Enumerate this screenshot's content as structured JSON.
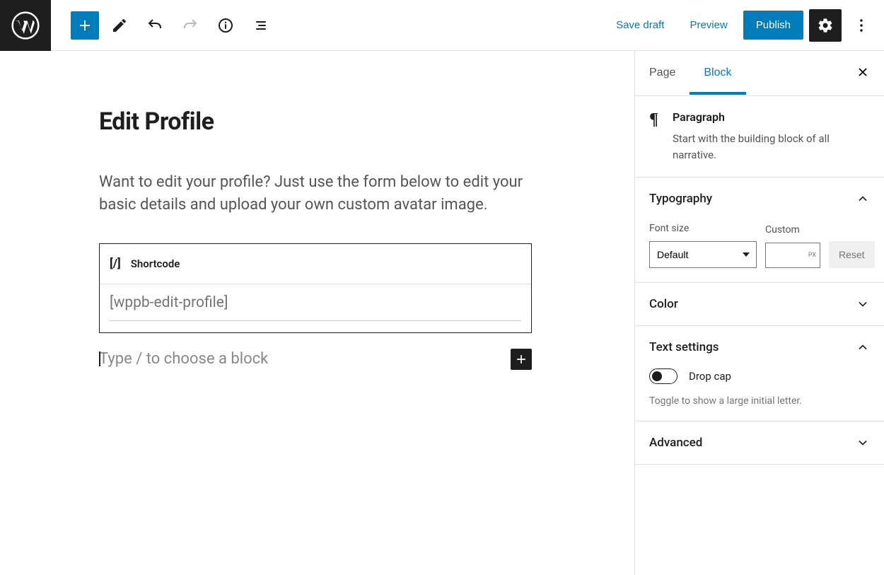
{
  "toolbar": {
    "save_draft": "Save draft",
    "preview": "Preview",
    "publish": "Publish"
  },
  "editor": {
    "title": "Edit Profile",
    "intro": "Want to edit your profile? Just use the form below to edit your basic details and upload your own custom avatar image.",
    "shortcode_label": "Shortcode",
    "shortcode_value": "[wppb-edit-profile]",
    "new_block_placeholder": "Type / to choose a block"
  },
  "sidebar": {
    "tabs": {
      "page": "Page",
      "block": "Block"
    },
    "block": {
      "name": "Paragraph",
      "description": "Start with the building block of all narrative."
    },
    "typography": {
      "title": "Typography",
      "font_size_label": "Font size",
      "font_size_value": "Default",
      "custom_label": "Custom",
      "custom_unit": "px",
      "reset": "Reset"
    },
    "color": {
      "title": "Color"
    },
    "text_settings": {
      "title": "Text settings",
      "dropcap_label": "Drop cap",
      "dropcap_desc": "Toggle to show a large initial letter."
    },
    "advanced": {
      "title": "Advanced"
    }
  }
}
